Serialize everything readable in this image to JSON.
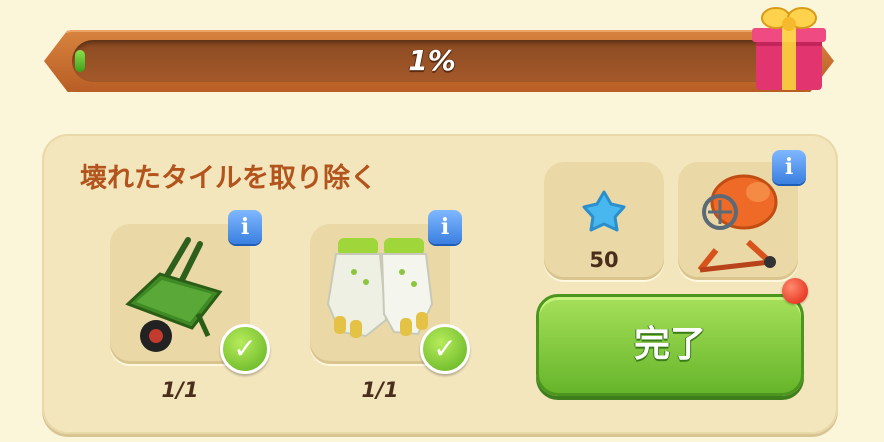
{
  "progress": {
    "label": "1%",
    "fraction": 0.01
  },
  "reward": {
    "icon": "gift-box-icon"
  },
  "task": {
    "title": "壊れたタイルを取り除く",
    "items": [
      {
        "icon": "wheelbarrow-icon",
        "count": "1/1",
        "completed": true
      },
      {
        "icon": "gloves-icon",
        "count": "1/1",
        "completed": true
      }
    ]
  },
  "rewards_panel": {
    "star": {
      "icon": "blue-star-icon",
      "value": "50"
    },
    "tool": {
      "icon": "cement-mixer-icon"
    }
  },
  "info_label": "i",
  "check_label": "✓",
  "complete_button": {
    "label": "完了"
  },
  "colors": {
    "title": "#b2541c",
    "button": "#7cc63a",
    "info": "#3a7fe0"
  }
}
